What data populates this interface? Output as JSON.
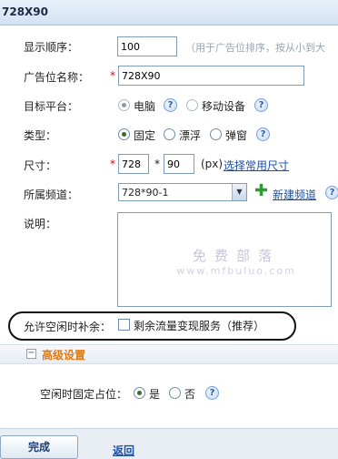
{
  "window": {
    "title": "728X90"
  },
  "form": {
    "display_order": {
      "label": "显示顺序：",
      "value": "100",
      "hint": "（用于广告位排序，按从小到大"
    },
    "ad_name": {
      "label": "广告位名称：",
      "required_mark": "*",
      "value": "728X90"
    },
    "platform": {
      "label": "目标平台：",
      "options": [
        "电脑",
        "移动设备"
      ],
      "selected": "电脑"
    },
    "type": {
      "label": "类型：",
      "options": [
        "固定",
        "漂浮",
        "弹窗"
      ],
      "selected": "固定"
    },
    "size": {
      "label": "尺寸：",
      "required_mark": "*",
      "width": "728",
      "times": "*",
      "height": "90",
      "unit": "(px)",
      "link": "选择常用尺寸"
    },
    "channel": {
      "label": "所属频道：",
      "value": "728*90-1",
      "new_link": "新建频道"
    },
    "description": {
      "label": "说明：",
      "value": ""
    },
    "idle_fill": {
      "label": "允许空闲时补余：",
      "checkbox_label": "剩余流量变现服务（推荐）",
      "checked": false
    },
    "help_icon": "?"
  },
  "watermark": {
    "line1": "免费部落",
    "line2": "www.mfbuluo.com"
  },
  "advanced": {
    "title": "高级设置",
    "collapse_glyph": "−",
    "idle_fixed": {
      "label": "空闲时固定占位：",
      "options": [
        "是",
        "否"
      ],
      "selected": "是"
    }
  },
  "footer": {
    "submit_label": "完成",
    "back_label": "返回"
  },
  "colors": {
    "accent": "#e07a10",
    "link": "#1f4fa0",
    "title_bg": "#d2e2f3"
  }
}
